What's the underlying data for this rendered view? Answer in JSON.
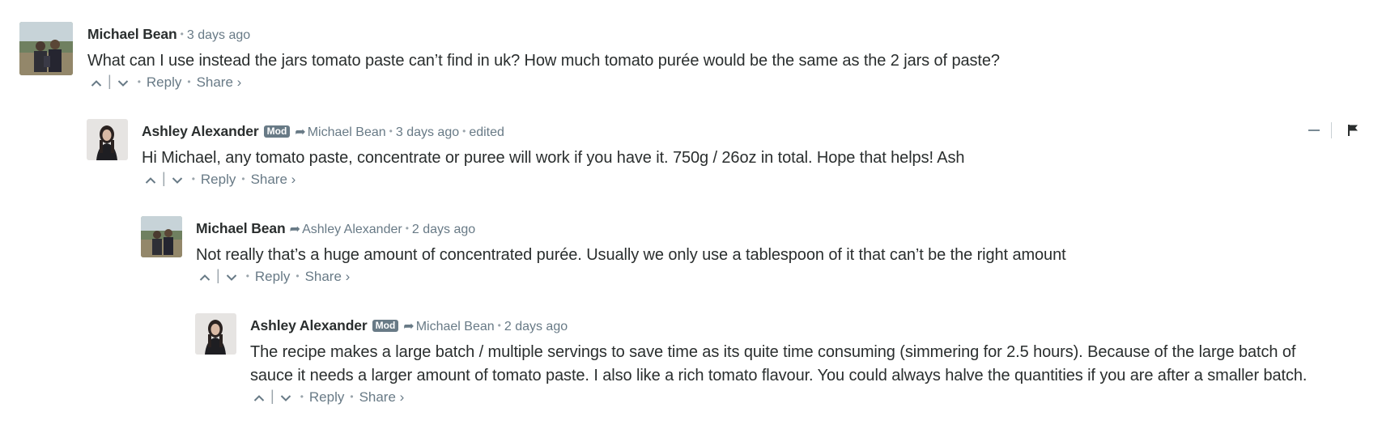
{
  "comments": [
    {
      "author": "Michael Bean",
      "time": "3 days ago",
      "text": "What can I use instead the jars tomato paste can’t find in uk? How much tomato purée would be the same as the 2 jars of paste?",
      "reply_label": "Reply",
      "share_label": "Share ›"
    },
    {
      "author": "Ashley Alexander",
      "badge": "Mod",
      "in_reply_to": "Michael Bean",
      "time": "3 days ago",
      "edited": "edited",
      "text": "Hi Michael, any tomato paste, concentrate or puree will work if you have it. 750g / 26oz in total. Hope that helps! Ash",
      "reply_label": "Reply",
      "share_label": "Share ›"
    },
    {
      "author": "Michael Bean",
      "in_reply_to": "Ashley Alexander",
      "time": "2 days ago",
      "text": "Not really that’s a huge amount of concentrated purée. Usually we only use a tablespoon of it that can’t be the right amount",
      "reply_label": "Reply",
      "share_label": "Share ›"
    },
    {
      "author": "Ashley Alexander",
      "badge": "Mod",
      "in_reply_to": "Michael Bean",
      "time": "2 days ago",
      "text_line1": "The recipe makes a large batch / multiple servings to save time as its quite time consuming (simmering for 2.5 hours). Because of the large batch of",
      "text_line2": "sauce it needs a larger amount of tomato paste. I also like a rich tomato flavour. You could always halve the quantities if you are after a smaller batch.",
      "reply_label": "Reply",
      "share_label": "Share ›"
    }
  ],
  "icons": {
    "upvote": "chevron-up-icon",
    "downvote": "chevron-down-icon",
    "reply_arrow": "reply-arrow-icon",
    "collapse": "minus-icon",
    "flag": "flag-icon"
  },
  "colors": {
    "text": "#2a2e2e",
    "meta": "#687a86",
    "mod_badge": "#687a86"
  }
}
